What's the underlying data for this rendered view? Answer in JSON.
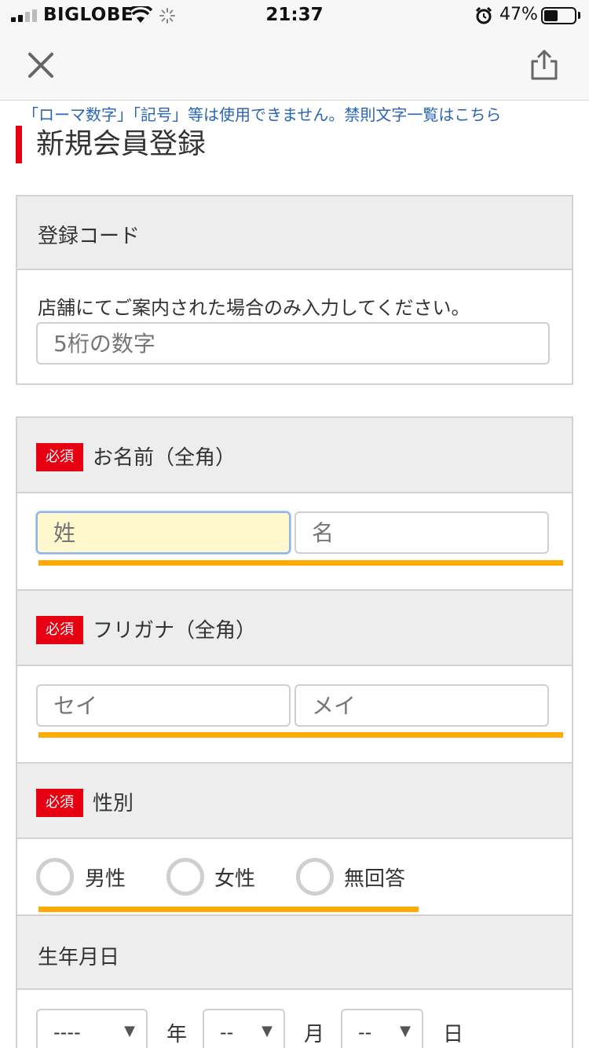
{
  "status_bar": {
    "carrier": "BIGLOBE",
    "time": "21:37",
    "battery_pct": "47%",
    "battery_level": 0.47,
    "icons": [
      "signal-icon",
      "wifi-icon",
      "loading-spinner-icon",
      "alarm-icon",
      "battery-icon"
    ]
  },
  "nav": {
    "close_icon": "close-icon",
    "share_icon": "share-icon"
  },
  "notice": "「ローマ数字」「記号」等は使用できません。禁則文字一覧はこちら",
  "page_title": "新規会員登録",
  "registration_code": {
    "label": "登録コード",
    "helper": "店舗にてご案内された場合のみ入力してください。",
    "placeholder": "5桁の数字"
  },
  "name": {
    "badge": "必須",
    "label": "お名前（全角）",
    "last_placeholder": "姓",
    "first_placeholder": "名"
  },
  "furigana": {
    "badge": "必須",
    "label": "フリガナ（全角）",
    "last_placeholder": "セイ",
    "first_placeholder": "メイ"
  },
  "gender": {
    "badge": "必須",
    "label": "性別",
    "options": [
      "男性",
      "女性",
      "無回答"
    ]
  },
  "birthdate": {
    "label": "生年月日",
    "year_value": "----",
    "month_value": "--",
    "day_value": "--",
    "year_unit": "年",
    "month_unit": "月",
    "day_unit": "日"
  },
  "colors": {
    "accent_red": "#e60012",
    "highlight_orange": "#ffaa00",
    "link_blue": "#2a64b5",
    "focused_field": "#fff8cf"
  }
}
